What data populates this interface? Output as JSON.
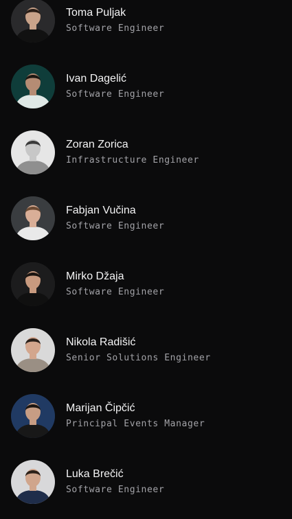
{
  "team": [
    {
      "name": "Toma Puljak",
      "role": "Software Engineer",
      "avatar_bg": "#2a2a2c",
      "shirt": "#111111",
      "skin": "#c9a38a",
      "hair": "#2b1f18"
    },
    {
      "name": "Ivan Dagelić",
      "role": "Software Engineer",
      "avatar_bg": "#0f3d3a",
      "shirt": "#dfe8e6",
      "skin": "#b58c74",
      "hair": "#1d1712"
    },
    {
      "name": "Zoran Zorica",
      "role": "Infrastructure Engineer",
      "avatar_bg": "#e6e6e6",
      "shirt": "#8f8f8f",
      "skin": "#c7c7c7",
      "hair": "#3a3a3a"
    },
    {
      "name": "Fabjan Vučina",
      "role": "Software Engineer",
      "avatar_bg": "#3a3d40",
      "shirt": "#e9e9e9",
      "skin": "#d9ae97",
      "hair": "#6b4a33"
    },
    {
      "name": "Mirko Džaja",
      "role": "Software Engineer",
      "avatar_bg": "#1c1c1d",
      "shirt": "#101010",
      "skin": "#c89a7f",
      "hair": "#1a1410"
    },
    {
      "name": "Nikola Radišić",
      "role": "Senior Solutions Engineer",
      "avatar_bg": "#d9d9d9",
      "shirt": "#9a8f84",
      "skin": "#d3a68d",
      "hair": "#2a201a"
    },
    {
      "name": "Marijan Čipčić",
      "role": "Principal Events Manager",
      "avatar_bg": "#203a63",
      "shirt": "#181818",
      "skin": "#c79d84",
      "hair": "#1b1511"
    },
    {
      "name": "Luka Brečić",
      "role": "Software Engineer",
      "avatar_bg": "#d8d8da",
      "shirt": "#1f2d4a",
      "skin": "#d0a58c",
      "hair": "#2b2019"
    }
  ]
}
